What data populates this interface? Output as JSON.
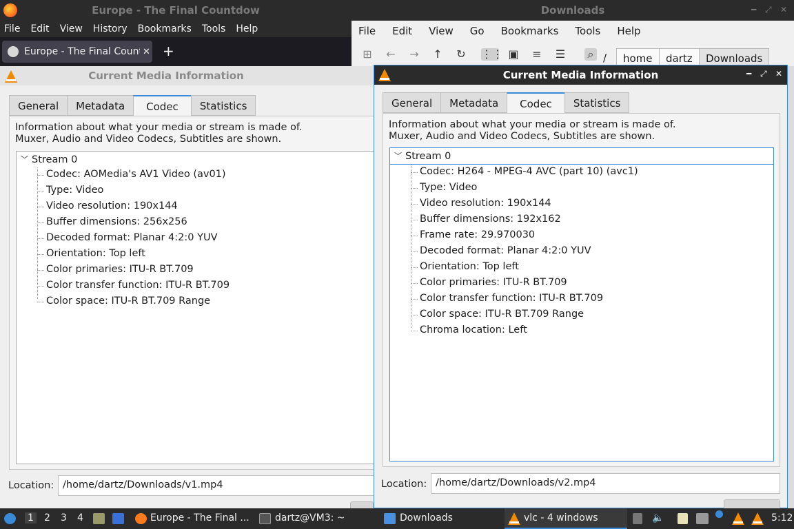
{
  "firefox": {
    "title": "Europe - The Final Countdow",
    "menu": [
      "File",
      "Edit",
      "View",
      "History",
      "Bookmarks",
      "Tools",
      "Help"
    ],
    "tab_title": "Europe - The Final Countdown",
    "tab_close": "✕",
    "new_tab": "+"
  },
  "filemanager": {
    "title": "Downloads",
    "menu": [
      "File",
      "Edit",
      "View",
      "Go",
      "Bookmarks",
      "Tools",
      "Help"
    ],
    "breadcrumbs": [
      "/",
      "home",
      "dartz",
      "Downloads"
    ]
  },
  "vlc_left": {
    "title": "Current Media Information",
    "tabs": [
      "General",
      "Metadata",
      "Codec",
      "Statistics"
    ],
    "active_tab": "Codec",
    "description_line1": "Information about what your media or stream is made of.",
    "description_line2": "Muxer, Audio and Video Codecs, Subtitles are shown.",
    "stream": "Stream 0",
    "properties": [
      "Codec: AOMedia's AV1 Video (av01)",
      "Type: Video",
      "Video resolution: 190x144",
      "Buffer dimensions: 256x256",
      "Decoded format: Planar 4:2:0 YUV",
      "Orientation: Top left",
      "Color primaries: ITU-R BT.709",
      "Color transfer function: ITU-R BT.709",
      "Color space: ITU-R BT.709 Range"
    ],
    "location_label": "Location:",
    "location": "/home/dartz/Downloads/v1.mp4"
  },
  "vlc_right": {
    "title": "Current Media Information",
    "tabs": [
      "General",
      "Metadata",
      "Codec",
      "Statistics"
    ],
    "active_tab": "Codec",
    "description_line1": "Information about what your media or stream is made of.",
    "description_line2": "Muxer, Audio and Video Codecs, Subtitles are shown.",
    "stream": "Stream 0",
    "properties": [
      "Codec: H264 - MPEG-4 AVC (part 10) (avc1)",
      "Type: Video",
      "Video resolution: 190x144",
      "Buffer dimensions: 192x162",
      "Frame rate: 29.970030",
      "Decoded format: Planar 4:2:0 YUV",
      "Orientation: Top left",
      "Color primaries: ITU-R BT.709",
      "Color transfer function: ITU-R BT.709",
      "Color space: ITU-R BT.709 Range",
      "Chroma location: Left"
    ],
    "location_label": "Location:",
    "location": "/home/dartz/Downloads/v2.mp4"
  },
  "taskbar": {
    "workspaces": [
      "1",
      "2",
      "3",
      "4"
    ],
    "tasks": [
      "Europe - The Final ...",
      "dartz@VM3: ~",
      "Downloads",
      "vlc - 4 windows"
    ],
    "clock": "5:12"
  },
  "colors": {
    "accent": "#3b8ad8",
    "vlc_orange": "#f28a00",
    "title_bar": "#2b2b2b"
  }
}
